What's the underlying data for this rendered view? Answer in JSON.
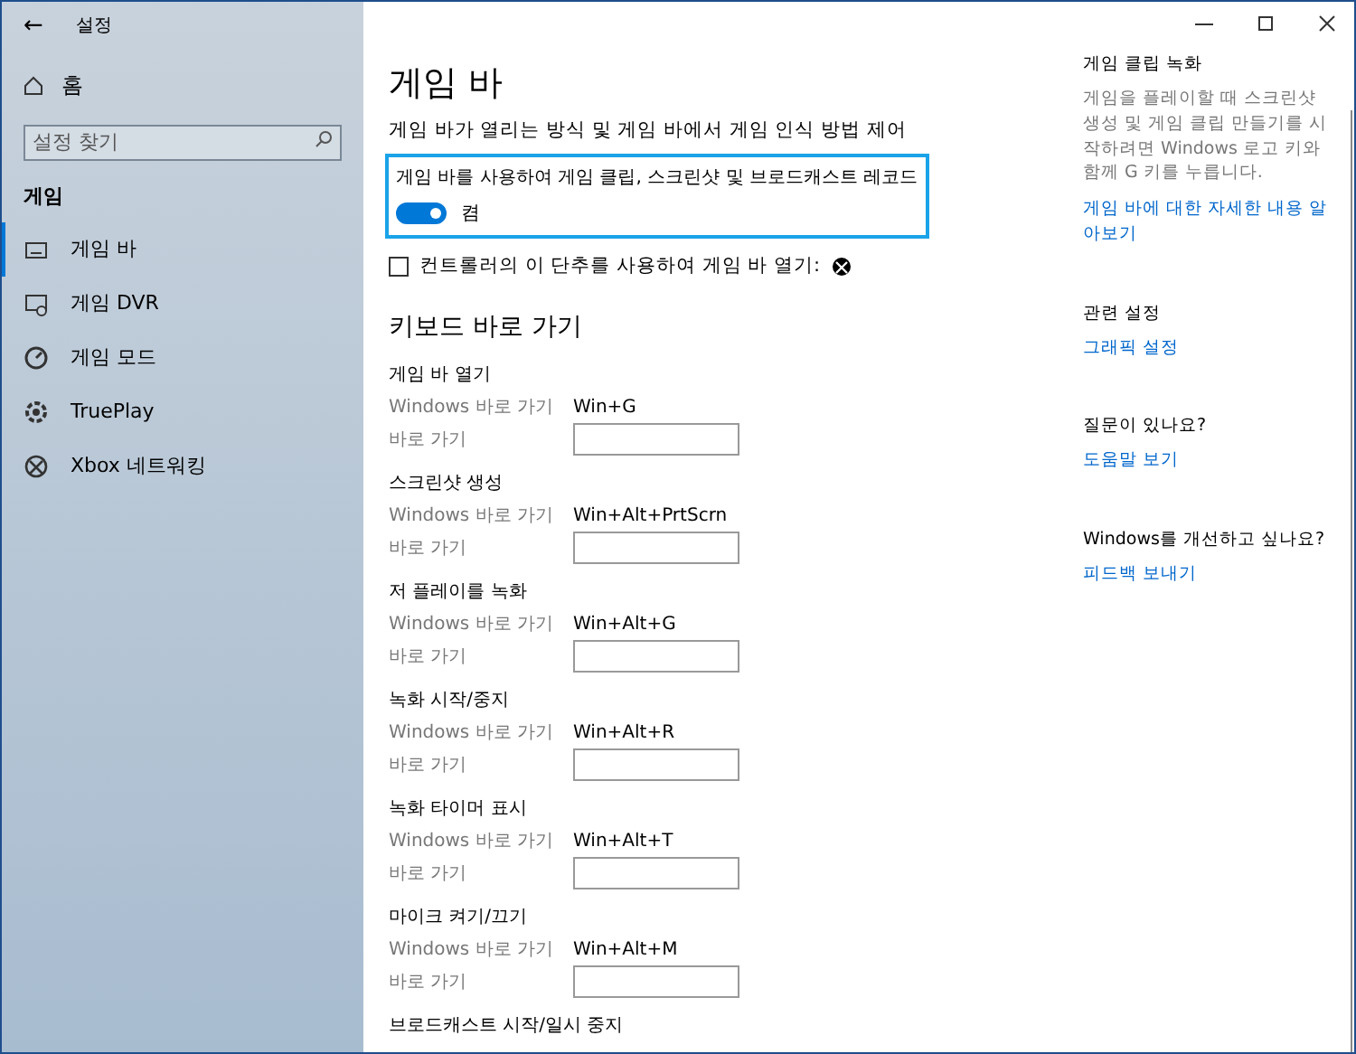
{
  "window": {
    "title": "설정",
    "back": "←"
  },
  "sidebar": {
    "home": "홈",
    "search": {
      "placeholder": "설정 찾기"
    },
    "section": "게임",
    "items": [
      {
        "label": "게임 바",
        "kind": "bar",
        "selected": true
      },
      {
        "label": "게임 DVR",
        "kind": "dvr",
        "selected": false
      },
      {
        "label": "게임 모드",
        "kind": "mode",
        "selected": false
      },
      {
        "label": "TruePlay",
        "kind": "trueplay",
        "selected": false
      },
      {
        "label": "Xbox 네트워킹",
        "kind": "xbox",
        "selected": false
      }
    ]
  },
  "main": {
    "title": "게임 바",
    "description": "게임 바가 열리는 방식 및 게임 바에서 게임 인식 방법 제어",
    "toggle": {
      "label": "게임 바를 사용하여 게임 클립, 스크린샷 및 브로드캐스트 레코드",
      "on": true,
      "state": "켬"
    },
    "checkbox": {
      "label": "컨트롤러의 이 단추를 사용하여 게임 바 열기:",
      "checked": false
    },
    "shortcuts_title": "키보드 바로 가기",
    "shortcuts": [
      {
        "name": "게임 바 열기",
        "windows_label": "Windows 바로 가기",
        "windows_value": "Win+G",
        "custom_label": "바로 가기"
      },
      {
        "name": "스크린샷 생성",
        "windows_label": "Windows 바로 가기",
        "windows_value": "Win+Alt+PrtScrn",
        "custom_label": "바로 가기"
      },
      {
        "name": "저 플레이를 녹화",
        "windows_label": "Windows 바로 가기",
        "windows_value": "Win+Alt+G",
        "custom_label": "바로 가기"
      },
      {
        "name": "녹화 시작/중지",
        "windows_label": "Windows 바로 가기",
        "windows_value": "Win+Alt+R",
        "custom_label": "바로 가기"
      },
      {
        "name": "녹화 타이머 표시",
        "windows_label": "Windows 바로 가기",
        "windows_value": "Win+Alt+T",
        "custom_label": "바로 가기"
      },
      {
        "name": "마이크 켜기/끄기",
        "windows_label": "Windows 바로 가기",
        "windows_value": "Win+Alt+M",
        "custom_label": "바로 가기"
      },
      {
        "name": "브로드캐스트 시작/일시 중지"
      }
    ]
  },
  "aside": [
    {
      "heading": "게임 클립 녹화",
      "text": "게임을 플레이할 때 스크린샷 생성 및 게임 클립 만들기를 시작하려면 Windows 로고 키와 함께 G 키를 누릅니다.",
      "link": "게임 바에 대한 자세한 내용 알아보기"
    },
    {
      "heading": "관련 설정",
      "link": "그래픽 설정"
    },
    {
      "heading": "질문이 있나요?",
      "link": "도움말 보기"
    },
    {
      "heading": "Windows를 개선하고 싶나요?",
      "link": "피드백 보내기"
    }
  ]
}
